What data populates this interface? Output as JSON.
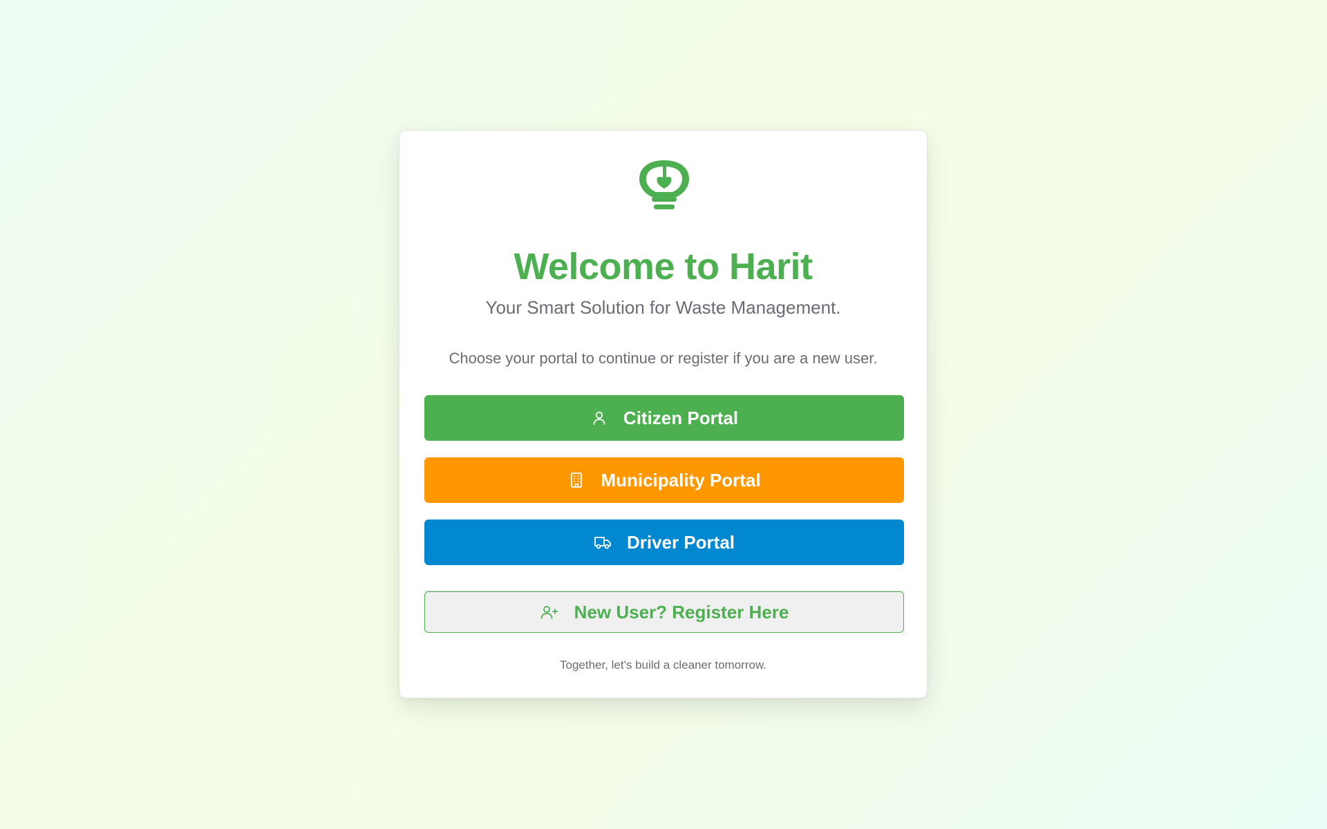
{
  "card": {
    "title": "Welcome to Harit",
    "subtitle": "Your Smart Solution for Waste Management.",
    "instruction": "Choose your portal to continue or register if you are a new user.",
    "footer": "Together, let's build a cleaner tomorrow."
  },
  "portals": [
    {
      "label": "Citizen Portal",
      "icon": "user-icon",
      "color": "#4caf50"
    },
    {
      "label": "Municipality Portal",
      "icon": "building-icon",
      "color": "#ff9800"
    },
    {
      "label": "Driver Portal",
      "icon": "truck-icon",
      "color": "#0288d1"
    }
  ],
  "register": {
    "label": "New User? Register Here",
    "icon": "user-plus-icon",
    "color": "#4caf50"
  },
  "logo": {
    "icon": "leaf-bulb-icon",
    "color": "#4caf50"
  }
}
